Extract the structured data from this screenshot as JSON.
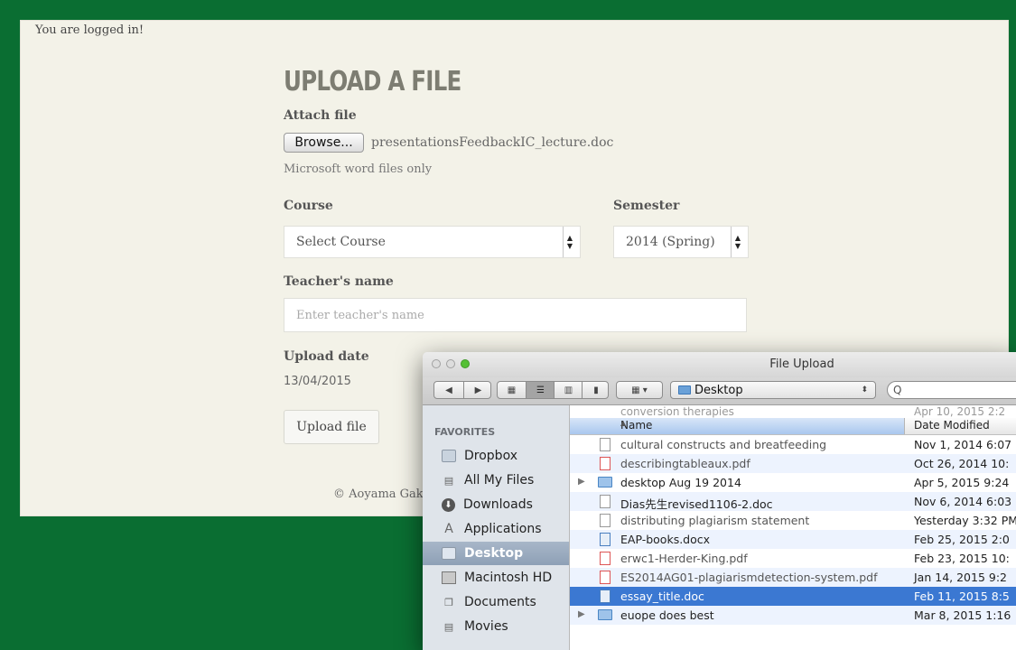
{
  "status": {
    "logged_in": "You are logged in!"
  },
  "form": {
    "title": "UPLOAD A FILE",
    "attach_label": "Attach file",
    "browse_label": "Browse...",
    "selected_file": "presentationsFeedbackIC_lecture.doc",
    "help_text": "Microsoft word files only",
    "course_label": "Course",
    "course_value": "Select Course",
    "semester_label": "Semester",
    "semester_value": "2014 (Spring)",
    "teacher_label": "Teacher's name",
    "teacher_placeholder": "Enter teacher's name",
    "date_label": "Upload date",
    "date_value": "13/04/2015",
    "upload_button": "Upload file"
  },
  "footer": {
    "text": "© Aoyama Gak"
  },
  "dialog": {
    "title": "File Upload",
    "location": "Desktop",
    "search_icon": "Q",
    "favorites_heading": "FAVORITES",
    "sidebar": [
      {
        "label": "Dropbox",
        "icon": "folder-icon"
      },
      {
        "label": "All My Files",
        "icon": "all-files-icon"
      },
      {
        "label": "Downloads",
        "icon": "downloads-icon"
      },
      {
        "label": "Applications",
        "icon": "applications-icon"
      },
      {
        "label": "Desktop",
        "icon": "desktop-icon",
        "selected": true
      },
      {
        "label": "Macintosh HD",
        "icon": "drive-icon"
      },
      {
        "label": "Documents",
        "icon": "documents-icon"
      },
      {
        "label": "Movies",
        "icon": "movies-icon"
      }
    ],
    "columns": {
      "name": "Name",
      "date": "Date Modified"
    },
    "peek_row": {
      "name": "conversion therapies",
      "date": "Apr 10, 2015 2:2"
    },
    "files": [
      {
        "name": "cultural constructs and breatfeeding",
        "date": "Nov 1, 2014 6:07",
        "kind": "doc"
      },
      {
        "name": "describingtableaux.pdf",
        "date": "Oct 26, 2014 10:",
        "kind": "pdf"
      },
      {
        "name": "desktop Aug 19 2014",
        "date": "Apr 5, 2015 9:24",
        "kind": "dir"
      },
      {
        "name": "Dias先生revised1106-2.doc",
        "date": "Nov 6, 2014 6:03",
        "kind": "doc"
      },
      {
        "name": "distributing plagiarism statement",
        "date": "Yesterday 3:32 PM",
        "kind": "doc"
      },
      {
        "name": "EAP-books.docx",
        "date": "Feb 25, 2015 2:0",
        "kind": "blue"
      },
      {
        "name": "erwc1-Herder-King.pdf",
        "date": "Feb 23, 2015 10:",
        "kind": "pdf"
      },
      {
        "name": "ES2014AG01-plagiarismdetection-system.pdf",
        "date": "Jan 14, 2015 9:2",
        "kind": "pdf"
      },
      {
        "name": "essay_title.doc",
        "date": "Feb 11, 2015 8:5",
        "kind": "blue",
        "selected": true
      },
      {
        "name": "euope does best",
        "date": "Mar 8, 2015 1:16",
        "kind": "dir"
      }
    ]
  }
}
